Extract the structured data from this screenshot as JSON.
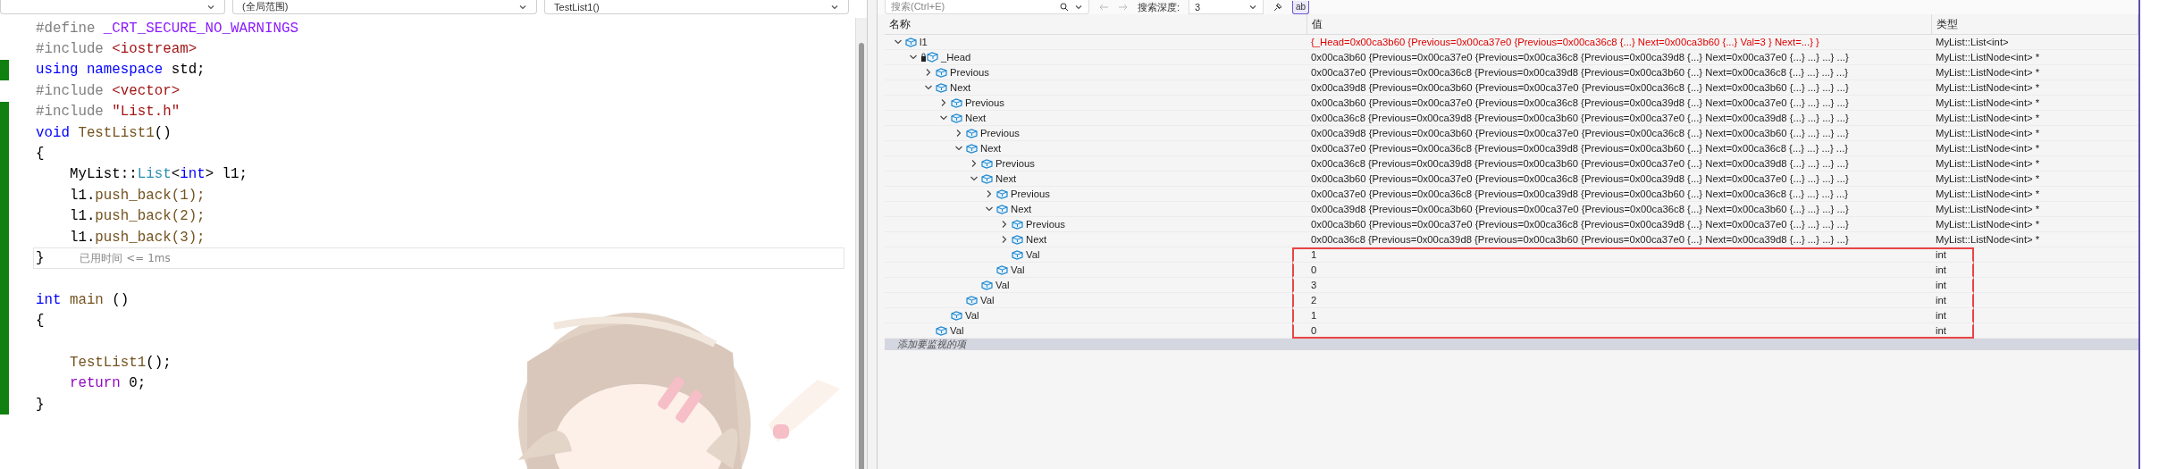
{
  "editor": {
    "nav": [
      {
        "label": "(全局范围)"
      },
      {
        "label": "TestList1()"
      }
    ],
    "lines": [
      {
        "modified": false,
        "current": false,
        "tokens": [
          {
            "kind": "preproc",
            "text": "#define "
          },
          {
            "kind": "macro",
            "text": "_CRT_SECURE_NO_WARNINGS"
          }
        ]
      },
      {
        "modified": false,
        "current": false,
        "tokens": [
          {
            "kind": "preproc",
            "text": "#include "
          },
          {
            "kind": "string",
            "text": "<iostream>"
          }
        ]
      },
      {
        "modified": true,
        "current": false,
        "tokens": [
          {
            "kind": "keyword",
            "text": "using namespace"
          },
          {
            "kind": "plain",
            "text": " std;"
          }
        ]
      },
      {
        "modified": false,
        "current": false,
        "tokens": [
          {
            "kind": "preproc",
            "text": "#include "
          },
          {
            "kind": "string",
            "text": "<vector>"
          }
        ]
      },
      {
        "modified": true,
        "current": false,
        "tokens": [
          {
            "kind": "preproc",
            "text": "#include "
          },
          {
            "kind": "string",
            "text": "\"List.h\""
          }
        ]
      },
      {
        "modified": true,
        "current": false,
        "tokens": [
          {
            "kind": "keyword",
            "text": "void"
          },
          {
            "kind": "func",
            "text": " TestList1"
          },
          {
            "kind": "plain",
            "text": "()"
          }
        ]
      },
      {
        "modified": true,
        "current": false,
        "tokens": [
          {
            "kind": "plain",
            "text": "{"
          }
        ]
      },
      {
        "modified": true,
        "current": false,
        "tokens": [
          {
            "kind": "plain",
            "text": "    MyList::"
          },
          {
            "kind": "type",
            "text": "List"
          },
          {
            "kind": "plain",
            "text": "<"
          },
          {
            "kind": "keyword",
            "text": "int"
          },
          {
            "kind": "plain",
            "text": "> l1;"
          }
        ]
      },
      {
        "modified": true,
        "current": false,
        "tokens": [
          {
            "kind": "plain",
            "text": "    l1."
          },
          {
            "kind": "func",
            "text": "push_back(1);"
          }
        ]
      },
      {
        "modified": true,
        "current": false,
        "tokens": [
          {
            "kind": "plain",
            "text": "    l1."
          },
          {
            "kind": "func",
            "text": "push_back(2);"
          }
        ]
      },
      {
        "modified": true,
        "current": false,
        "tokens": [
          {
            "kind": "plain",
            "text": "    l1."
          },
          {
            "kind": "func",
            "text": "push_back(3);"
          }
        ]
      },
      {
        "modified": true,
        "current": true,
        "tokens": [
          {
            "kind": "plain",
            "text": "}"
          }
        ],
        "hint": "已用时间 <= 1ms"
      },
      {
        "modified": true,
        "current": false
      },
      {
        "modified": true,
        "current": false,
        "tokens": [
          {
            "kind": "keyword",
            "text": "int"
          },
          {
            "kind": "func",
            "text": " main"
          },
          {
            "kind": "plain",
            "text": " ()"
          }
        ]
      },
      {
        "modified": true,
        "current": false,
        "tokens": [
          {
            "kind": "plain",
            "text": "{"
          }
        ]
      },
      {
        "modified": true,
        "current": false
      },
      {
        "modified": true,
        "current": false,
        "tokens": [
          {
            "kind": "func",
            "text": "    TestList1"
          },
          {
            "kind": "plain",
            "text": "();"
          }
        ]
      },
      {
        "modified": true,
        "current": false,
        "tokens": [
          {
            "kind": "control",
            "text": "    return"
          },
          {
            "kind": "plain",
            "text": " 0;"
          }
        ]
      },
      {
        "modified": true,
        "current": false,
        "tokens": [
          {
            "kind": "plain",
            "text": "}"
          }
        ]
      }
    ]
  },
  "watch": {
    "search": {
      "placeholder": "搜索(Ctrl+E)"
    },
    "depth_label": "搜索深度:",
    "depth": "3",
    "format_button": {
      "label": "ab",
      "selected": true
    },
    "columns": [
      "名称",
      "值",
      "类型"
    ],
    "rows": [
      {
        "name": "l1",
        "kind": "member",
        "expanded": true,
        "changed": true,
        "highlighted": false,
        "value": "{_Head=0x00ca3b60 {Previous=0x00ca37e0 {Previous=0x00ca36c8 {...} Next=0x00ca3b60 {...} Val=3 } Next=...} }",
        "type": "MyList::List<int>",
        "children": [
          {
            "name": "_Head",
            "kind": "private_member",
            "expanded": true,
            "changed": false,
            "highlighted": false,
            "value": "0x00ca3b60 {Previous=0x00ca37e0 {Previous=0x00ca36c8 {Previous=0x00ca39d8 {...} Next=0x00ca37e0 {...} ...} ...} ...}",
            "type": "MyList::ListNode<int> *",
            "children": [
              {
                "name": "Previous",
                "kind": "member",
                "expanded": false,
                "changed": false,
                "highlighted": false,
                "value": "0x00ca37e0 {Previous=0x00ca36c8 {Previous=0x00ca39d8 {Previous=0x00ca3b60 {...} Next=0x00ca36c8 {...} ...} ...} ...}",
                "type": "MyList::ListNode<int> *"
              },
              {
                "name": "Next",
                "kind": "member",
                "expanded": true,
                "changed": false,
                "highlighted": false,
                "value": "0x00ca39d8 {Previous=0x00ca3b60 {Previous=0x00ca37e0 {Previous=0x00ca36c8 {...} Next=0x00ca3b60 {...} ...} ...} ...}",
                "type": "MyList::ListNode<int> *",
                "children": [
                  {
                    "name": "Previous",
                    "kind": "member",
                    "expanded": false,
                    "changed": false,
                    "highlighted": false,
                    "value": "0x00ca3b60 {Previous=0x00ca37e0 {Previous=0x00ca36c8 {Previous=0x00ca39d8 {...} Next=0x00ca37e0 {...} ...} ...} ...}",
                    "type": "MyList::ListNode<int> *"
                  },
                  {
                    "name": "Next",
                    "kind": "member",
                    "expanded": true,
                    "changed": false,
                    "highlighted": false,
                    "value": "0x00ca36c8 {Previous=0x00ca39d8 {Previous=0x00ca3b60 {Previous=0x00ca37e0 {...} Next=0x00ca39d8 {...} ...} ...} ...}",
                    "type": "MyList::ListNode<int> *",
                    "children": [
                      {
                        "name": "Previous",
                        "kind": "member",
                        "expanded": false,
                        "changed": false,
                        "highlighted": false,
                        "value": "0x00ca39d8 {Previous=0x00ca3b60 {Previous=0x00ca37e0 {Previous=0x00ca36c8 {...} Next=0x00ca3b60 {...} ...} ...} ...}",
                        "type": "MyList::ListNode<int> *"
                      },
                      {
                        "name": "Next",
                        "kind": "member",
                        "expanded": true,
                        "changed": false,
                        "highlighted": false,
                        "value": "0x00ca37e0 {Previous=0x00ca36c8 {Previous=0x00ca39d8 {Previous=0x00ca3b60 {...} Next=0x00ca36c8 {...} ...} ...} ...}",
                        "type": "MyList::ListNode<int> *",
                        "children": [
                          {
                            "name": "Previous",
                            "kind": "member",
                            "expanded": false,
                            "changed": false,
                            "highlighted": false,
                            "value": "0x00ca36c8 {Previous=0x00ca39d8 {Previous=0x00ca3b60 {Previous=0x00ca37e0 {...} Next=0x00ca39d8 {...} ...} ...} ...}",
                            "type": "MyList::ListNode<int> *"
                          },
                          {
                            "name": "Next",
                            "kind": "member",
                            "expanded": true,
                            "changed": false,
                            "highlighted": false,
                            "value": "0x00ca3b60 {Previous=0x00ca37e0 {Previous=0x00ca36c8 {Previous=0x00ca39d8 {...} Next=0x00ca37e0 {...} ...} ...} ...}",
                            "type": "MyList::ListNode<int> *",
                            "children": [
                              {
                                "name": "Previous",
                                "kind": "member",
                                "expanded": false,
                                "changed": false,
                                "highlighted": false,
                                "value": "0x00ca37e0 {Previous=0x00ca36c8 {Previous=0x00ca39d8 {Previous=0x00ca3b60 {...} Next=0x00ca36c8 {...} ...} ...} ...}",
                                "type": "MyList::ListNode<int> *"
                              },
                              {
                                "name": "Next",
                                "kind": "member",
                                "expanded": true,
                                "changed": false,
                                "highlighted": false,
                                "value": "0x00ca39d8 {Previous=0x00ca3b60 {Previous=0x00ca37e0 {Previous=0x00ca36c8 {...} Next=0x00ca3b60 {...} ...} ...} ...}",
                                "type": "MyList::ListNode<int> *",
                                "children": [
                                  {
                                    "name": "Previous",
                                    "kind": "member",
                                    "expanded": false,
                                    "changed": false,
                                    "highlighted": false,
                                    "value": "0x00ca3b60 {Previous=0x00ca37e0 {Previous=0x00ca36c8 {Previous=0x00ca39d8 {...} Next=0x00ca37e0 {...} ...} ...} ...}",
                                    "type": "MyList::ListNode<int> *"
                                  },
                                  {
                                    "name": "Next",
                                    "kind": "member",
                                    "expanded": false,
                                    "changed": false,
                                    "highlighted": false,
                                    "value": "0x00ca36c8 {Previous=0x00ca39d8 {Previous=0x00ca3b60 {Previous=0x00ca37e0 {...} Next=0x00ca39d8 {...} ...} ...} ...}",
                                    "type": "MyList::ListNode<int> *"
                                  },
                                  {
                                    "name": "Val",
                                    "kind": "member",
                                    "changed": false,
                                    "highlighted": true,
                                    "value": "1",
                                    "type": "int"
                                  }
                                ]
                              },
                              {
                                "name": "Val",
                                "kind": "member",
                                "changed": false,
                                "highlighted": true,
                                "value": "0",
                                "type": "int"
                              }
                            ]
                          },
                          {
                            "name": "Val",
                            "kind": "member",
                            "changed": false,
                            "highlighted": true,
                            "value": "3",
                            "type": "int"
                          }
                        ]
                      },
                      {
                        "name": "Val",
                        "kind": "member",
                        "changed": false,
                        "highlighted": true,
                        "value": "2",
                        "type": "int"
                      }
                    ]
                  },
                  {
                    "name": "Val",
                    "kind": "member",
                    "changed": false,
                    "highlighted": true,
                    "value": "1",
                    "type": "int"
                  }
                ]
              },
              {
                "name": "Val",
                "kind": "member",
                "changed": false,
                "highlighted": true,
                "value": "0",
                "type": "int"
              }
            ]
          }
        ]
      }
    ],
    "add_item_placeholder": "添加要监视的项"
  }
}
